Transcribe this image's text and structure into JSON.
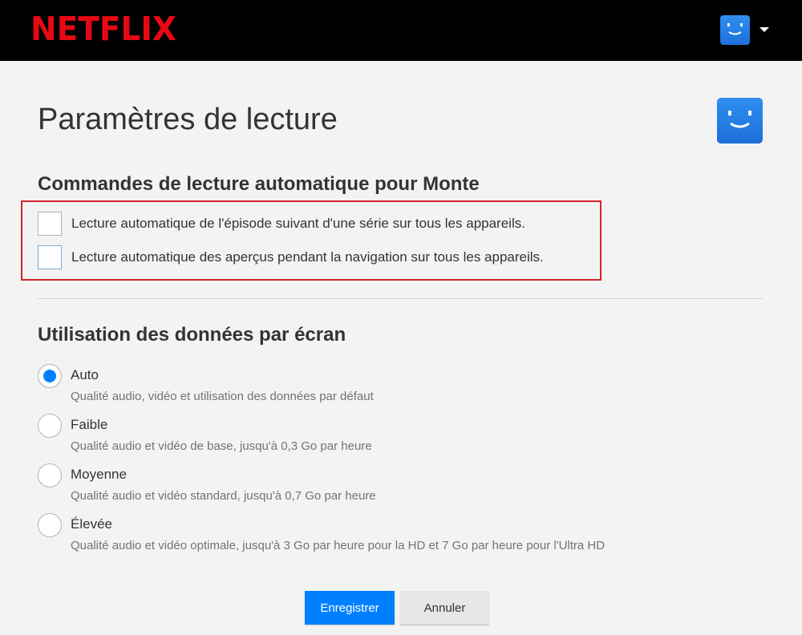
{
  "header": {
    "logo": "NETFLIX",
    "avatar_icon": "profile-smiley-icon",
    "menu_icon": "caret-down-icon"
  },
  "page": {
    "title": "Paramètres de lecture",
    "avatar_icon": "profile-smiley-icon"
  },
  "autoplay": {
    "title": "Commandes de lecture automatique pour Monte",
    "options": [
      {
        "label": "Lecture automatique de l'épisode suivant d'une série sur tous les appareils.",
        "checked": false
      },
      {
        "label": "Lecture automatique des aperçus pendant la navigation sur tous les appareils.",
        "checked": false
      }
    ]
  },
  "data_usage": {
    "title": "Utilisation des données par écran",
    "options": [
      {
        "label": "Auto",
        "description": "Qualité audio, vidéo et utilisation des données par défaut",
        "selected": true
      },
      {
        "label": "Faible",
        "description": "Qualité audio et vidéo de base, jusqu'à 0,3 Go par heure",
        "selected": false
      },
      {
        "label": "Moyenne",
        "description": "Qualité audio et vidéo standard, jusqu'à 0,7 Go par heure",
        "selected": false
      },
      {
        "label": "Élevée",
        "description": "Qualité audio et vidéo optimale, jusqu'à 3 Go par heure pour la HD et 7 Go par heure pour l'Ultra HD",
        "selected": false
      }
    ]
  },
  "buttons": {
    "save": "Enregistrer",
    "cancel": "Annuler"
  },
  "colors": {
    "brand_red": "#e50914",
    "accent_blue": "#0080ff",
    "highlight_border": "#d2232a"
  }
}
